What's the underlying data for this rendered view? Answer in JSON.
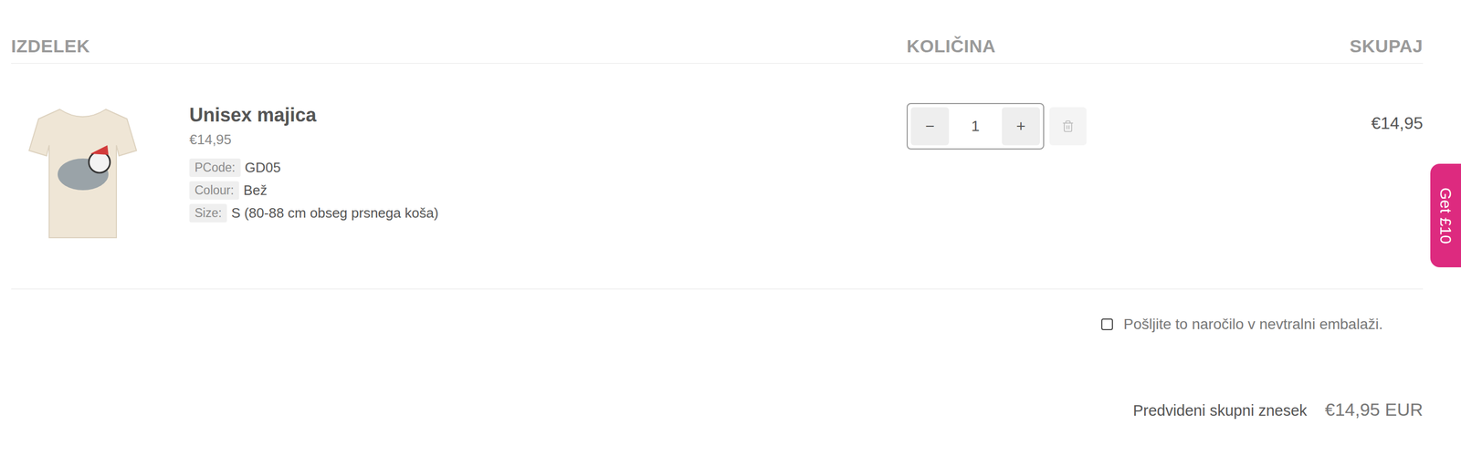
{
  "table": {
    "columns": [
      "IZDELEK",
      "KOLIČINA",
      "SKUPAJ"
    ]
  },
  "items": [
    {
      "name": "Unisex majica",
      "price": "€14,95",
      "attributes": [
        {
          "label": "PCode:",
          "value": "GD05"
        },
        {
          "label": "Colour:",
          "value": "Bež"
        },
        {
          "label": "Size:",
          "value": "S (80-88 cm obseg prsnega koša)"
        }
      ],
      "decrement": "−",
      "quantity": "1",
      "increment": "+",
      "total": "€14,95"
    }
  ],
  "options": [
    {
      "label": "Pošljite to naročilo v nevtralni embalaži.",
      "checked": false
    }
  ],
  "summary": {
    "label": "Predvideni skupni znesek",
    "value": "€14,95 EUR"
  },
  "promo_tab": {
    "label": "Get £10"
  }
}
